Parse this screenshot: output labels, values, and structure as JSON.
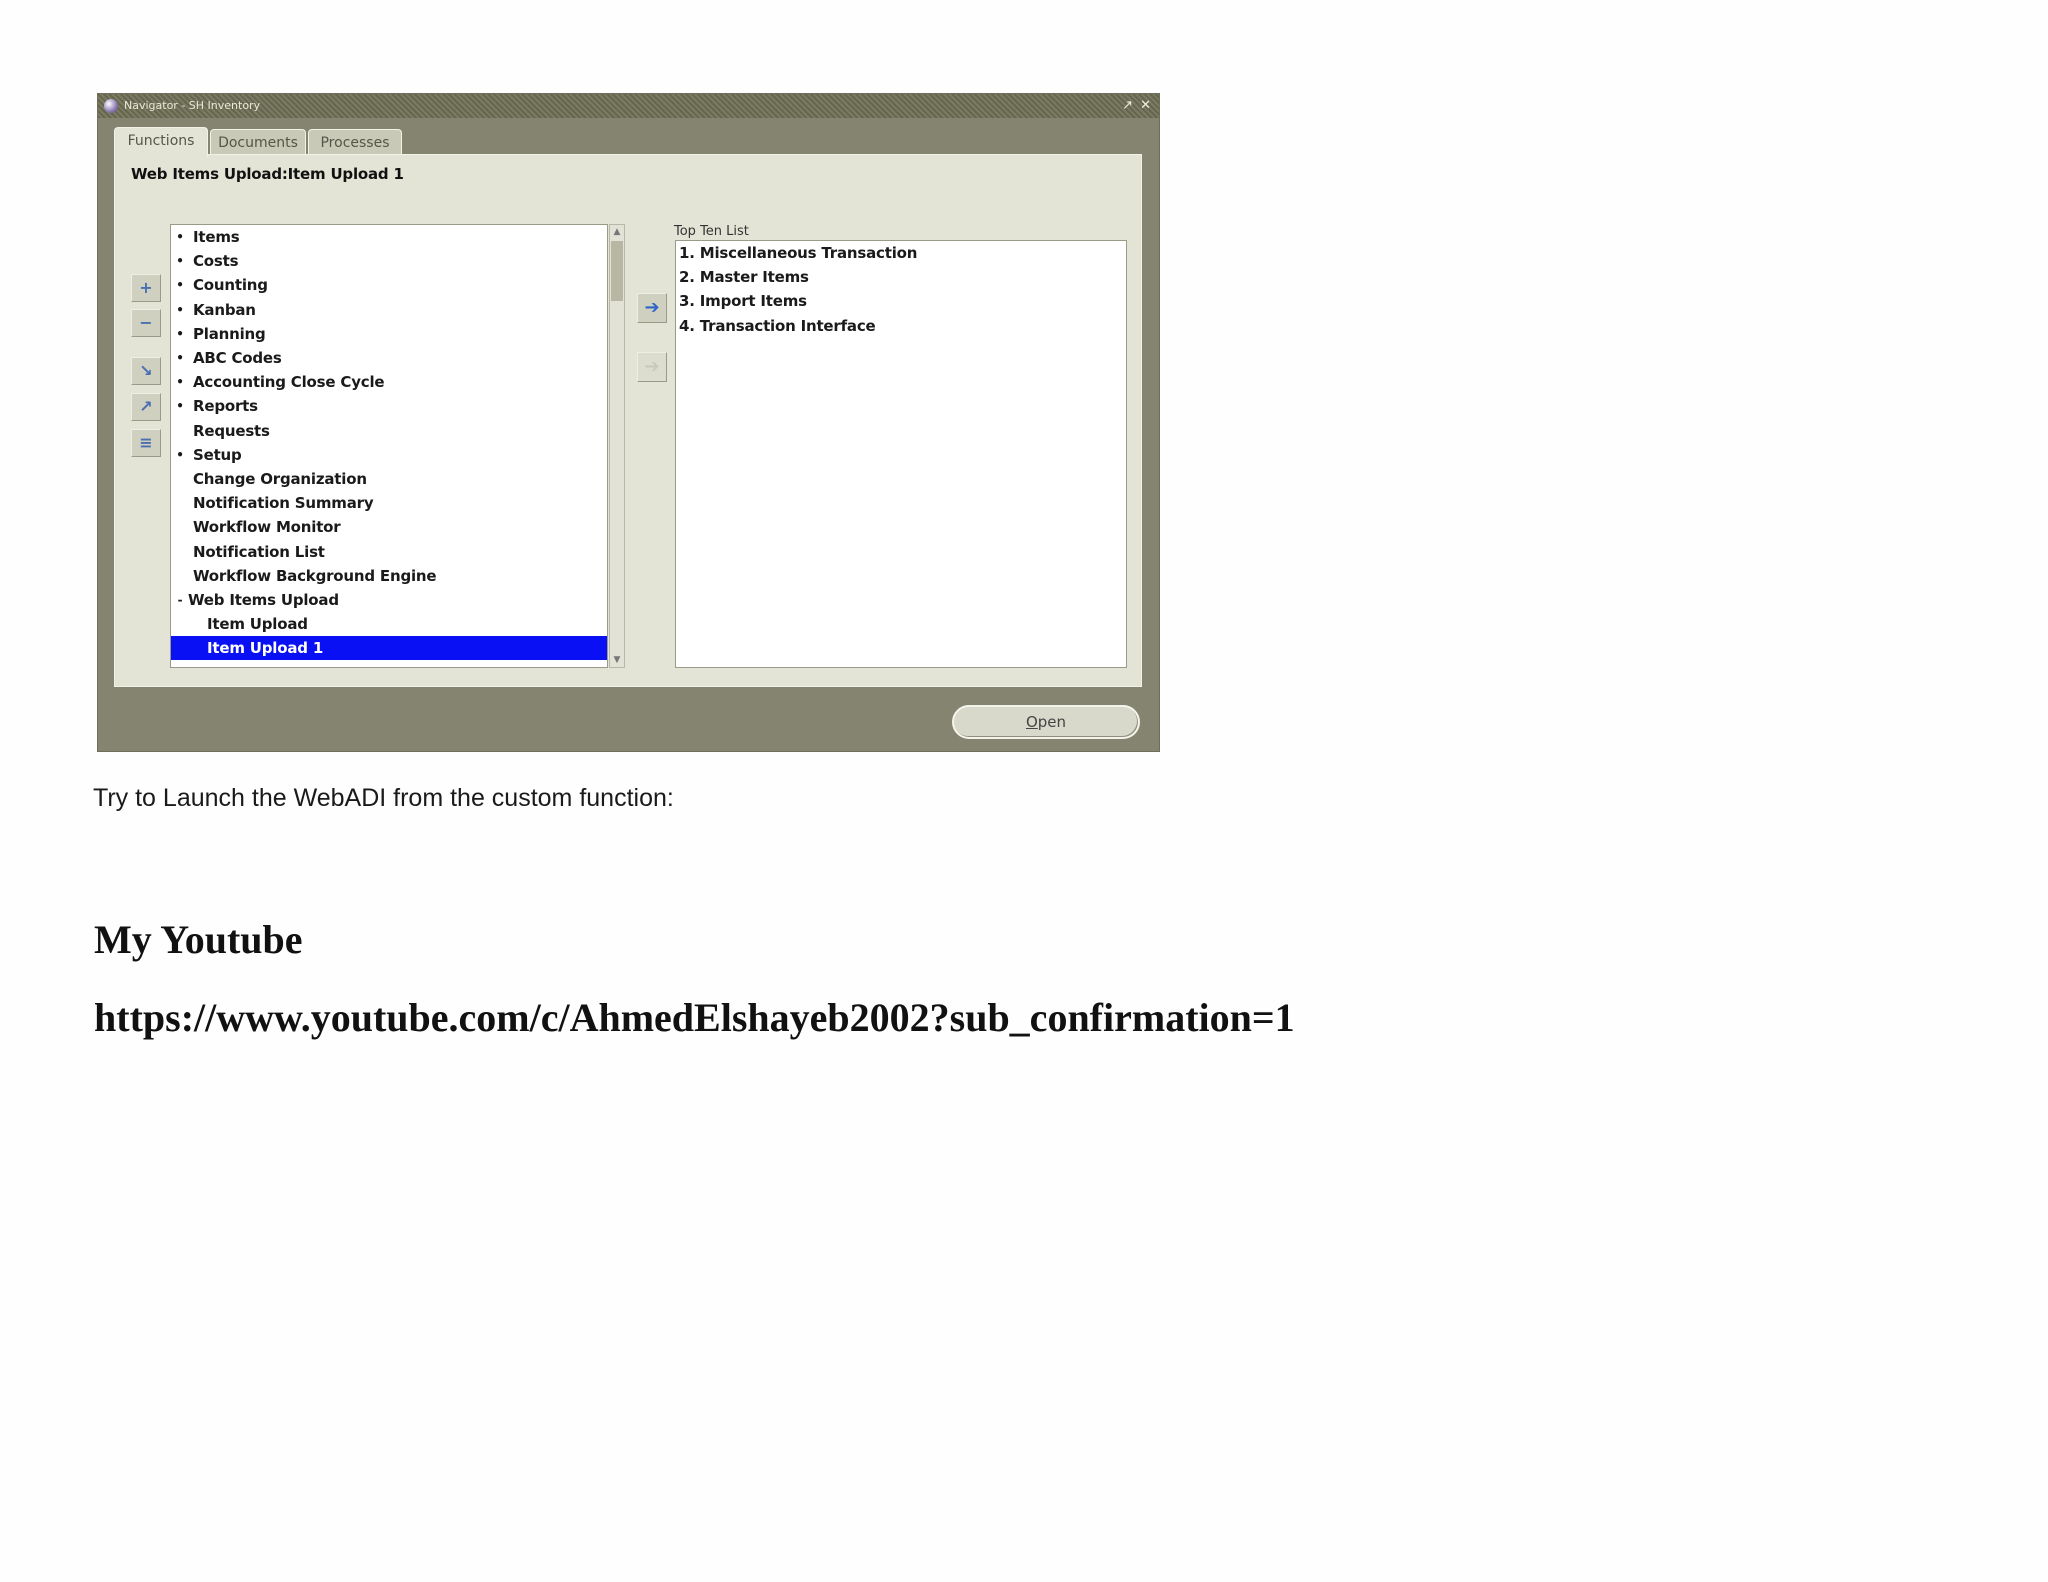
{
  "window": {
    "title": "Navigator - SH Inventory",
    "minimize_glyph": "↗",
    "close_glyph": "✕"
  },
  "tabs": [
    {
      "label": "Functions",
      "active": true
    },
    {
      "label": "Documents",
      "active": false
    },
    {
      "label": "Processes",
      "active": false
    }
  ],
  "path_label": "Web Items Upload:Item Upload 1",
  "toolbar_icons": [
    "expand-icon",
    "collapse-icon",
    "expand-branch-icon",
    "expand-all-icon",
    "collapse-all-icon"
  ],
  "tree_items": [
    {
      "label": "Items",
      "bullet": "•",
      "type": "collapsed"
    },
    {
      "label": "Costs",
      "bullet": "•",
      "type": "collapsed"
    },
    {
      "label": "Counting",
      "bullet": "•",
      "type": "collapsed"
    },
    {
      "label": "Kanban",
      "bullet": "•",
      "type": "collapsed"
    },
    {
      "label": "Planning",
      "bullet": "•",
      "type": "collapsed"
    },
    {
      "label": "ABC Codes",
      "bullet": "•",
      "type": "collapsed"
    },
    {
      "label": "Accounting Close Cycle",
      "bullet": "•",
      "type": "collapsed"
    },
    {
      "label": "Reports",
      "bullet": "•",
      "type": "collapsed"
    },
    {
      "label": "Requests",
      "bullet": "",
      "type": "leaf"
    },
    {
      "label": "Setup",
      "bullet": "•",
      "type": "collapsed"
    },
    {
      "label": "Change Organization",
      "bullet": "",
      "type": "leaf"
    },
    {
      "label": "Notification Summary",
      "bullet": "",
      "type": "leaf"
    },
    {
      "label": "Workflow Monitor",
      "bullet": "",
      "type": "leaf"
    },
    {
      "label": "Notification List",
      "bullet": "",
      "type": "leaf"
    },
    {
      "label": "Workflow Background Engine",
      "bullet": "",
      "type": "leaf"
    },
    {
      "label": "Web Items Upload",
      "bullet": "-",
      "type": "open"
    },
    {
      "label": "Item Upload",
      "bullet": "",
      "type": "child"
    },
    {
      "label": "Item Upload 1",
      "bullet": "",
      "type": "child",
      "selected": true
    }
  ],
  "top_ten": {
    "label": "Top Ten List",
    "items": [
      "1. Miscellaneous Transaction",
      "2. Master Items",
      "3. Import Items",
      "4. Transaction Interface"
    ]
  },
  "open_button": {
    "label_underlined": "O",
    "label_rest": "pen"
  },
  "caption": "Try to Launch the WebADI from the custom function:",
  "youtube": {
    "heading": "My Youtube",
    "link": "https://www.youtube.com/c/AhmedElshayeb2002?sub_confirmation=1"
  },
  "colors": {
    "window_bg": "#848470",
    "panel_bg": "#e4e4d6",
    "selection": "#0a10f4"
  }
}
